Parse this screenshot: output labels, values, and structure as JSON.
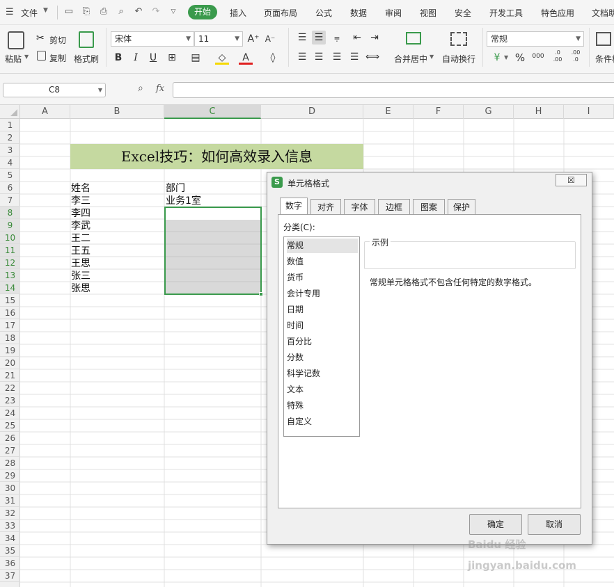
{
  "menu": {
    "file": "文件",
    "tabs": [
      "开始",
      "插入",
      "页面布局",
      "公式",
      "数据",
      "审阅",
      "视图",
      "安全",
      "开发工具",
      "特色应用",
      "文档助"
    ]
  },
  "ribbon": {
    "paste": "粘贴",
    "cut": "剪切",
    "copy": "复制",
    "format_painter": "格式刷",
    "font_name": "宋体",
    "font_size": "11",
    "merge_center": "合并居中",
    "wrap_text": "自动换行",
    "number_format": "常规",
    "percent": "%",
    "thousands": "000",
    "inc_decimal": ".0 .00",
    "dec_decimal": ".00 .0",
    "conditional": "条件格"
  },
  "formula_bar": {
    "name_box": "C8",
    "fx": "fx",
    "value": ""
  },
  "columns": [
    "A",
    "B",
    "C",
    "D",
    "E",
    "F",
    "G",
    "H",
    "I"
  ],
  "rows": [
    "1",
    "2",
    "3",
    "4",
    "5",
    "6",
    "7",
    "8",
    "9",
    "10",
    "11",
    "12",
    "13",
    "14",
    "15",
    "16",
    "17",
    "18",
    "19",
    "20",
    "21",
    "22",
    "23",
    "24",
    "25",
    "26",
    "27",
    "28",
    "29",
    "30",
    "31",
    "32",
    "33",
    "34",
    "35",
    "36",
    "37"
  ],
  "sheet": {
    "title": "Excel技巧：如何高效录入信息",
    "header_name": "姓名",
    "header_dept": "部门",
    "names": [
      "李三",
      "李四",
      "李武",
      "王二",
      "王五",
      "王思",
      "张三",
      "张思"
    ],
    "dept_c7": "业务1室"
  },
  "colors": {
    "accent": "#3a9a4c",
    "title_fill": "#c5d9a0",
    "selection_fill": "#d9d9d9"
  },
  "dialog": {
    "title": "单元格格式",
    "close": "☒",
    "tabs": [
      "数字",
      "对齐",
      "字体",
      "边框",
      "图案",
      "保护"
    ],
    "category_label": "分类(C):",
    "categories": [
      "常规",
      "数值",
      "货币",
      "会计专用",
      "日期",
      "时间",
      "百分比",
      "分数",
      "科学记数",
      "文本",
      "特殊",
      "自定义"
    ],
    "selected_category": "常规",
    "sample_label": "示例",
    "description": "常规单元格格式不包含任何特定的数字格式。",
    "ok": "确定",
    "cancel": "取消"
  },
  "watermark": "Baidu 经验 jingyan.baidu.com"
}
